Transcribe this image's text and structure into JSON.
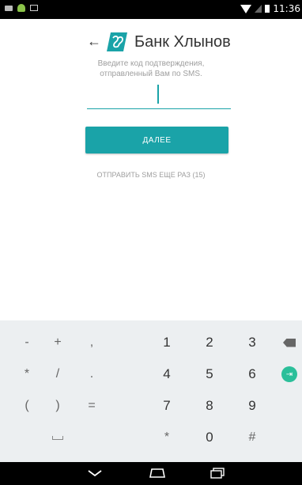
{
  "status_bar": {
    "time": "11:36"
  },
  "header": {
    "back_arrow": "←",
    "bank_name": "Банк Хлынов",
    "logo_icon": "bank-logo-icon"
  },
  "hint": {
    "line1": "Введите код подтверждения,",
    "line2": "отправленный Вам по SMS."
  },
  "code_input": {
    "value": "",
    "placeholder": ""
  },
  "next_button": {
    "label": "ДАЛЕЕ"
  },
  "resend": {
    "label": "ОТПРАВИТЬ SMS ЕЩЕ РАЗ (15)"
  },
  "keyboard": {
    "keys": [
      "-",
      "+",
      ",",
      "1",
      "2",
      "3",
      "*",
      "/",
      ".",
      "4",
      "5",
      "6",
      "(",
      ")",
      "=",
      "7",
      "8",
      "9",
      "*",
      "0",
      "#"
    ]
  },
  "colors": {
    "accent": "#1aa3a8",
    "keyboard_bg": "#eceff1",
    "next_key": "#2bbf9a"
  }
}
